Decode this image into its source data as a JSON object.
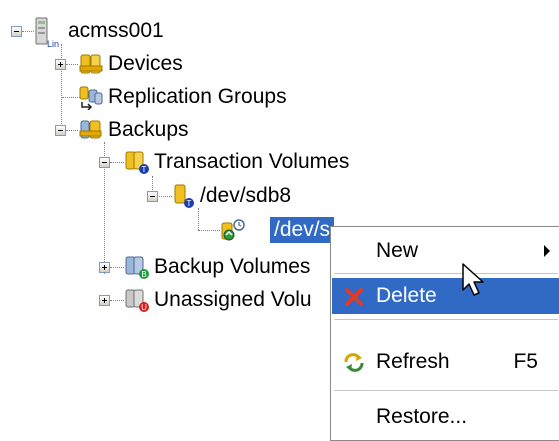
{
  "tree": {
    "root": {
      "label": "acmss001",
      "badge": "Lin",
      "icon": "server-icon",
      "state": "expanded"
    },
    "items": [
      {
        "label": "Devices",
        "icon": "devices-icon",
        "state": "collapsed"
      },
      {
        "label": "Replication Groups",
        "icon": "replication-groups-icon",
        "state": "none"
      },
      {
        "label": "Backups",
        "icon": "backups-icon",
        "state": "expanded"
      },
      {
        "label": "Transaction Volumes",
        "icon": "transaction-volumes-icon",
        "state": "expanded"
      },
      {
        "label": "/dev/sdb8",
        "icon": "transaction-volume-icon",
        "state": "expanded"
      },
      {
        "label": "/dev/s",
        "icon": "backup-history-icon",
        "state": "selected"
      },
      {
        "label": "Backup Volumes",
        "icon": "backup-volumes-icon",
        "state": "collapsed"
      },
      {
        "label": "Unassigned Volu",
        "icon": "unassigned-volumes-icon",
        "state": "collapsed"
      }
    ]
  },
  "context_menu": {
    "items": [
      {
        "label": "New",
        "shortcut": "",
        "submenu": true,
        "icon": ""
      },
      {
        "label": "Delete",
        "shortcut": "",
        "submenu": false,
        "icon": "delete-x-icon",
        "highlighted": true
      },
      {
        "label": "Refresh",
        "shortcut": "F5",
        "submenu": false,
        "icon": "refresh-icon"
      },
      {
        "label": "Restore...",
        "shortcut": "",
        "submenu": false,
        "icon": ""
      }
    ]
  },
  "colors": {
    "selection": "#316ac5",
    "delete_icon": "#e03a2a",
    "folder_yellow": "#f0c020",
    "badge_blue": "#1a3fb0",
    "badge_green": "#1f9a3a",
    "badge_red": "#d21e1e"
  }
}
